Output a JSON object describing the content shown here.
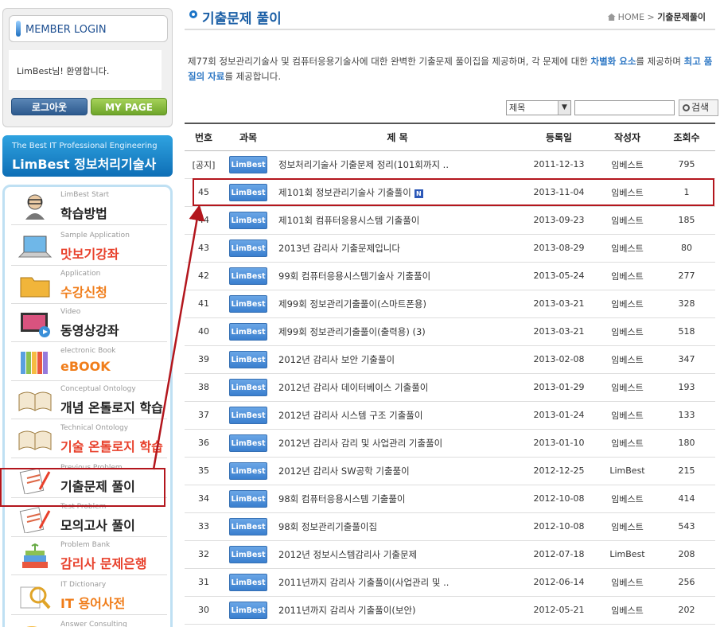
{
  "sidebar": {
    "login_title": "MEMBER LOGIN",
    "welcome": "LimBest님! 환영합니다.",
    "logout_label": "로그아웃",
    "mypage_label": "MY PAGE",
    "banner_line1": "The Best IT Professional Engineering",
    "banner_line2": "LimBest 정보처리기술사",
    "menu": [
      {
        "en": "LimBest Start",
        "ko": "학습방법",
        "icon": "student-icon",
        "color": "#222222"
      },
      {
        "en": "Sample Application",
        "ko": "맛보기강좌",
        "icon": "laptop-icon",
        "color": "#e8412c"
      },
      {
        "en": "Application",
        "ko": "수강신청",
        "icon": "folder-icon",
        "color": "#f07d1a"
      },
      {
        "en": "Video",
        "ko": "동영상강좌",
        "icon": "video-icon",
        "color": "#222222"
      },
      {
        "en": "electronic Book",
        "ko": "eBOOK",
        "icon": "books-icon",
        "color": "#f07d1a"
      },
      {
        "en": "Conceptual Ontology",
        "ko": "개념 온톨로지 학습",
        "icon": "open-book-icon",
        "color": "#222222"
      },
      {
        "en": "Technical Ontology",
        "ko": "기술 온톨로지 학습",
        "icon": "open-book-icon",
        "color": "#e8412c"
      },
      {
        "en": "Previous Problem",
        "ko": "기출문제 풀이",
        "icon": "exam-paper-icon",
        "color": "#222222"
      },
      {
        "en": "Test Problem",
        "ko": "모의고사 풀이",
        "icon": "exam-paper-icon",
        "color": "#222222"
      },
      {
        "en": "Problem Bank",
        "ko": "감리사 문제은행",
        "icon": "book-stack-icon",
        "color": "#e8412c"
      },
      {
        "en": "IT Dictionary",
        "ko": "IT 용어사전",
        "icon": "magnifier-icon",
        "color": "#f07d1a"
      },
      {
        "en": "Answer Consulting",
        "ko": "",
        "icon": "consulting-icon",
        "color": "#222222"
      }
    ]
  },
  "header": {
    "title": "기출문제 풀이",
    "breadcrumb_home": "HOME",
    "breadcrumb_sep": ">",
    "breadcrumb_current": "기출문제풀이"
  },
  "intro": {
    "part1": "제77회 정보관리기술사 및 컴퓨터응용기술사에 대한 완벽한 기출문제 풀이집을 제공하며, 각 문제에 대한 ",
    "em1": "차별화 요소",
    "part2": "를 제공하며 ",
    "em2": "최고 품질의 자료",
    "part3": "를 제공합니다."
  },
  "search": {
    "select_value": "제목",
    "button_label": "검색"
  },
  "table": {
    "headers": [
      "번호",
      "과목",
      "제 목",
      "등록일",
      "작성자",
      "조회수"
    ],
    "tag_label": "LimBest",
    "new_badge": "N",
    "rows": [
      {
        "no": "[공지]",
        "title": "정보처리기술사 기출문제 정리(101회까지 ..",
        "date": "2011-12-13",
        "author": "임베스트",
        "views": "795",
        "new": false
      },
      {
        "no": "45",
        "title": "제101회 정보관리기술사 기출풀이",
        "date": "2013-11-04",
        "author": "임베스트",
        "views": "1",
        "new": true
      },
      {
        "no": "44",
        "title": "제101회 컴퓨터응용시스템 기출풀이",
        "date": "2013-09-23",
        "author": "임베스트",
        "views": "185",
        "new": false
      },
      {
        "no": "43",
        "title": "2013년 감리사 기출문제입니다",
        "date": "2013-08-29",
        "author": "임베스트",
        "views": "80",
        "new": false
      },
      {
        "no": "42",
        "title": "99회 컴퓨터응용시스템기술사 기출풀이",
        "date": "2013-05-24",
        "author": "임베스트",
        "views": "277",
        "new": false
      },
      {
        "no": "41",
        "title": "제99회 정보관리기출풀이(스마트폰용)",
        "date": "2013-03-21",
        "author": "임베스트",
        "views": "328",
        "new": false
      },
      {
        "no": "40",
        "title": "제99회 정보관리기출풀이(출력용) (3)",
        "date": "2013-03-21",
        "author": "임베스트",
        "views": "518",
        "new": false
      },
      {
        "no": "39",
        "title": "2012년 감리사 보안 기출풀이",
        "date": "2013-02-08",
        "author": "임베스트",
        "views": "347",
        "new": false
      },
      {
        "no": "38",
        "title": "2012년 감리사 데이터베이스 기출풀이",
        "date": "2013-01-29",
        "author": "임베스트",
        "views": "193",
        "new": false
      },
      {
        "no": "37",
        "title": "2012년 감리사 시스템 구조 기출풀이",
        "date": "2013-01-24",
        "author": "임베스트",
        "views": "133",
        "new": false
      },
      {
        "no": "36",
        "title": "2012년 감리사 감리 및 사업관리 기출풀이",
        "date": "2013-01-10",
        "author": "임베스트",
        "views": "180",
        "new": false
      },
      {
        "no": "35",
        "title": "2012년 감리사 SW공학 기출풀이",
        "date": "2012-12-25",
        "author": "LimBest",
        "views": "215",
        "new": false
      },
      {
        "no": "34",
        "title": "98회 컴퓨터응용시스템 기출풀이",
        "date": "2012-10-08",
        "author": "임베스트",
        "views": "414",
        "new": false
      },
      {
        "no": "33",
        "title": "98회 정보관리기출풀이집",
        "date": "2012-10-08",
        "author": "임베스트",
        "views": "543",
        "new": false
      },
      {
        "no": "32",
        "title": "2012년 정보시스템감리사 기출문제",
        "date": "2012-07-18",
        "author": "LimBest",
        "views": "208",
        "new": false
      },
      {
        "no": "31",
        "title": "2011년까지 감리사 기출풀이(사업관리 및 ..",
        "date": "2012-06-14",
        "author": "임베스트",
        "views": "256",
        "new": false
      },
      {
        "no": "30",
        "title": "2011년까지 감리사 기출풀이(보안)",
        "date": "2012-05-21",
        "author": "임베스트",
        "views": "202",
        "new": false
      }
    ]
  },
  "colors": {
    "accent": "#1b5fa6",
    "highlight": "#b3161d",
    "tag_blue": "#3a7fcf"
  }
}
